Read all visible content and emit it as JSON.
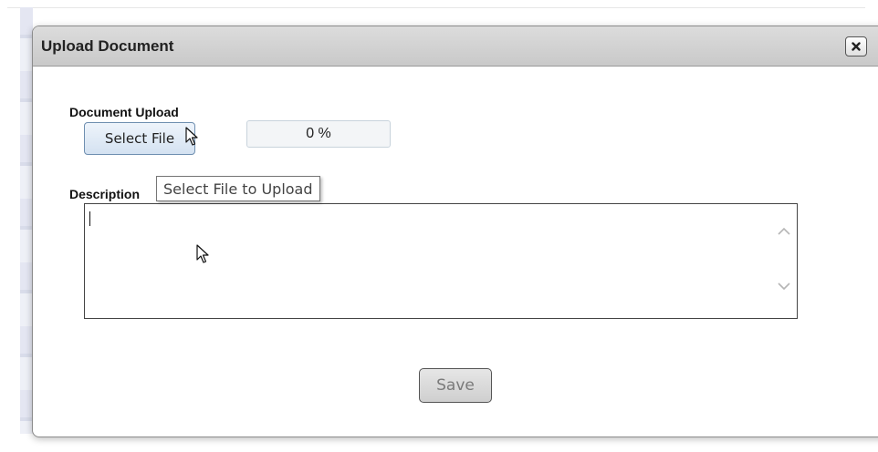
{
  "dialog": {
    "title": "Upload Document",
    "close_icon": "close-icon"
  },
  "upload": {
    "section_label": "Document Upload",
    "select_file_label": "Select File",
    "progress_text": "0 %",
    "progress_value": 0,
    "tooltip": "Select File to Upload"
  },
  "description": {
    "label": "Description",
    "value": ""
  },
  "actions": {
    "save_label": "Save",
    "save_enabled": false
  },
  "icons": {
    "close": "close-icon",
    "scroll_up": "chevron-up-icon",
    "scroll_down": "chevron-down-icon",
    "cursor": "mouse-pointer-icon"
  },
  "colors": {
    "titlebar": "#d0d0d0",
    "select_button": "#dce8f5",
    "disabled_text": "#7a7a7a"
  }
}
